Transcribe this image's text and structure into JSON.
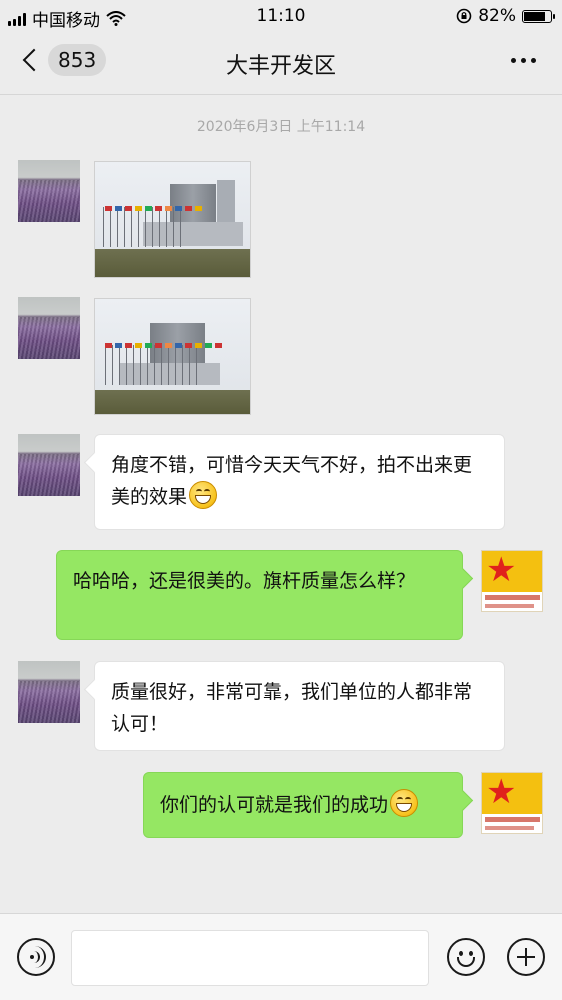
{
  "status_bar": {
    "carrier": "中国移动",
    "time": "11:10",
    "battery_percent": "82%",
    "battery_level": 0.82,
    "icons": [
      "signal-icon",
      "wifi-icon",
      "rotation-lock-icon",
      "battery-icon"
    ]
  },
  "header": {
    "back_count": "853",
    "title": "大丰开发区",
    "more_icon": "more-icon"
  },
  "chat": {
    "timestamp": "2020年6月3日 上午11:14",
    "messages": [
      {
        "side": "left",
        "type": "image",
        "content": "office-building-with-flags-photo"
      },
      {
        "side": "left",
        "type": "image",
        "content": "office-building-with-flags-photo"
      },
      {
        "side": "left",
        "type": "text",
        "text": "角度不错，可惜今天天气不好，拍不出来更美的效果",
        "emoji": "grin-emoji"
      },
      {
        "side": "right",
        "type": "text",
        "text": "哈哈哈，还是很美的。旗杆质量怎么样？"
      },
      {
        "side": "left",
        "type": "text",
        "text": "质量很好，非常可靠，我们单位的人都非常认可！"
      },
      {
        "side": "right",
        "type": "text",
        "text": "你们的认可就是我们的成功",
        "emoji": "grin-emoji"
      }
    ]
  },
  "input_bar": {
    "voice_icon": "voice-icon",
    "emoji_icon": "emoji-icon",
    "plus_icon": "plus-icon",
    "value": ""
  },
  "colors": {
    "background": "#ececec",
    "bubble_self": "#95e763",
    "bubble_other": "#ffffff",
    "timestamp": "#a8a8a8"
  }
}
